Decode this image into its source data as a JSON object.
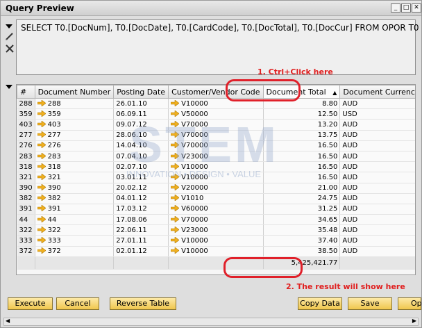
{
  "window": {
    "title": "Query Preview"
  },
  "sql": "SELECT T0.[DocNum], T0.[DocDate], T0.[CardCode], T0.[DocTotal], T0.[DocCur] FROM OPOR T0",
  "annotations": {
    "step1": "1. Ctrl+Click here",
    "step2": "2. The result will show here"
  },
  "watermark": {
    "text": "STEM",
    "tagline": "INNOVATION • DESIGN • VALUE"
  },
  "table": {
    "headers": {
      "hash": "#",
      "docnum": "Document Number",
      "date": "Posting Date",
      "cust": "Customer/Vendor Code",
      "total": "Document Total",
      "cur": "Document Currency"
    },
    "rows": [
      {
        "idx": "288",
        "docnum": "288",
        "date": "26.01.10",
        "cust": "V10000",
        "total": "8.80",
        "cur": "AUD"
      },
      {
        "idx": "359",
        "docnum": "359",
        "date": "06.09.11",
        "cust": "V50000",
        "total": "12.50",
        "cur": "USD"
      },
      {
        "idx": "403",
        "docnum": "403",
        "date": "09.07.12",
        "cust": "V70000",
        "total": "13.20",
        "cur": "AUD"
      },
      {
        "idx": "277",
        "docnum": "277",
        "date": "28.06.10",
        "cust": "V70000",
        "total": "13.75",
        "cur": "AUD"
      },
      {
        "idx": "276",
        "docnum": "276",
        "date": "14.04.10",
        "cust": "V70000",
        "total": "16.50",
        "cur": "AUD"
      },
      {
        "idx": "283",
        "docnum": "283",
        "date": "07.04.10",
        "cust": "V23000",
        "total": "16.50",
        "cur": "AUD"
      },
      {
        "idx": "318",
        "docnum": "318",
        "date": "02.07.10",
        "cust": "V10000",
        "total": "16.50",
        "cur": "AUD"
      },
      {
        "idx": "321",
        "docnum": "321",
        "date": "03.01.11",
        "cust": "V10000",
        "total": "16.50",
        "cur": "AUD"
      },
      {
        "idx": "390",
        "docnum": "390",
        "date": "20.02.12",
        "cust": "V20000",
        "total": "21.00",
        "cur": "AUD"
      },
      {
        "idx": "382",
        "docnum": "382",
        "date": "04.01.12",
        "cust": "V1010",
        "total": "24.75",
        "cur": "AUD"
      },
      {
        "idx": "391",
        "docnum": "391",
        "date": "17.03.12",
        "cust": "V60000",
        "total": "31.25",
        "cur": "AUD"
      },
      {
        "idx": "44",
        "docnum": "44",
        "date": "17.08.06",
        "cust": "V70000",
        "total": "34.65",
        "cur": "AUD"
      },
      {
        "idx": "322",
        "docnum": "322",
        "date": "22.06.11",
        "cust": "V23000",
        "total": "35.48",
        "cur": "AUD"
      },
      {
        "idx": "333",
        "docnum": "333",
        "date": "27.01.11",
        "cust": "V10000",
        "total": "37.40",
        "cur": "AUD"
      },
      {
        "idx": "372",
        "docnum": "372",
        "date": "02.01.12",
        "cust": "V10000",
        "total": "38.50",
        "cur": "AUD"
      }
    ],
    "total": "5,425,421.77"
  },
  "buttons": {
    "execute": "Execute",
    "cancel": "Cancel",
    "reverse": "Reverse Table",
    "copy": "Copy Data",
    "save": "Save",
    "open": "Op"
  },
  "colors": {
    "accent": "#e0202a",
    "button": "#f0c64d",
    "arrow": "#f0b020"
  }
}
